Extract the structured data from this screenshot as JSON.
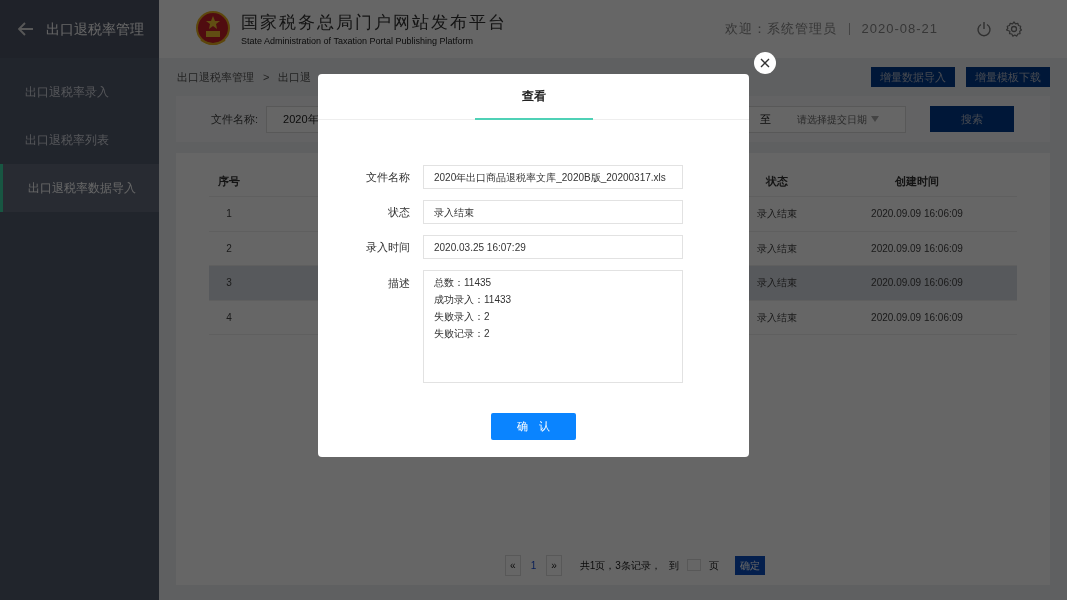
{
  "sidebar": {
    "title": "出口退税率管理",
    "items": [
      {
        "label": "出口退税率录入",
        "selected": false
      },
      {
        "label": "出口退税率列表",
        "selected": false
      },
      {
        "label": "出口退税率数据导入",
        "selected": true
      }
    ]
  },
  "header": {
    "title": "国家税务总局门户网站发布平台",
    "subtitle": "State Administration of Taxation Portal Publishing Platform",
    "welcome": "欢迎：系统管理员",
    "date": "2020-08-21"
  },
  "breadcrumb": [
    "出口退税率管理",
    ">",
    "出口退"
  ],
  "actions": [
    "增量数据导入",
    "增量模板下载"
  ],
  "filter": {
    "label": "文件名称:",
    "value": "2020年",
    "to": "至",
    "date_placeholder": "请选择提交日期",
    "search": "搜索"
  },
  "table": {
    "columns": [
      "序号",
      "状态",
      "创建时间"
    ],
    "rows": [
      {
        "cells": [
          "1",
          "录入结束",
          "2020.09.09 16:06:09"
        ],
        "selected": false
      },
      {
        "cells": [
          "2",
          "录入结束",
          "2020.09.09 16:06:09"
        ],
        "selected": false
      },
      {
        "cells": [
          "3",
          "录入结束",
          "2020.09.09 16:06:09"
        ],
        "selected": true
      },
      {
        "cells": [
          "4",
          "录入结束",
          "2020.09.09 16:06:09"
        ],
        "selected": false
      }
    ]
  },
  "pagination": {
    "first": "«",
    "page": "1",
    "last": "»",
    "summary": "共1页，3条记录，",
    "goto": "到",
    "unit": "页",
    "confirm": "确定"
  },
  "dialog": {
    "tab": "查看",
    "fields": [
      {
        "label": "文件名称",
        "value": "2020年出口商品退税率文库_2020B版_20200317.xls"
      },
      {
        "label": "状态",
        "value": "录入结束"
      },
      {
        "label": "录入时间",
        "value": "2020.03.25 16:07:29"
      }
    ],
    "description": {
      "label": "描述",
      "lines": [
        "总数：11435",
        "成功录入：11433",
        "失败录入：2",
        "失败记录：2"
      ]
    },
    "confirm": "确　认"
  }
}
